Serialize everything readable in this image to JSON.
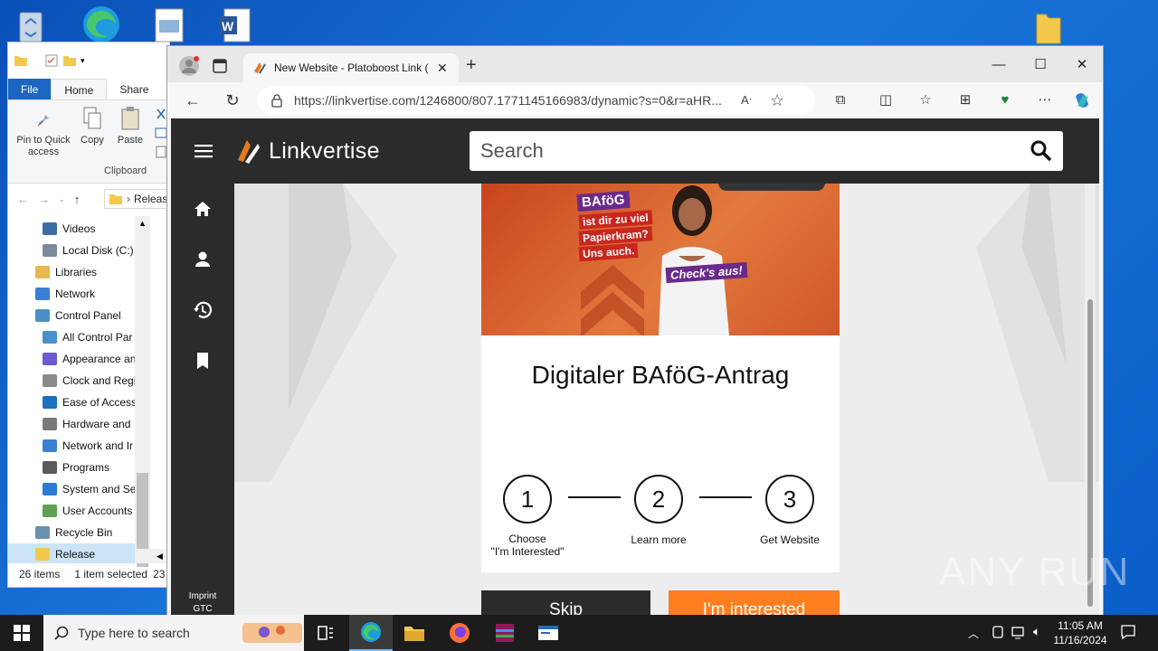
{
  "explorer": {
    "ribbon_tabs": [
      "File",
      "Home",
      "Share"
    ],
    "ribbon": {
      "pin_label": "Pin to Quick access",
      "copy_label": "Copy",
      "paste_label": "Paste",
      "group_label": "Clipboard"
    },
    "address_text": "Releas",
    "nav_items": [
      {
        "label": "Videos",
        "icon": "videos-icon",
        "color": "#3a6ea5"
      },
      {
        "label": "Local Disk (C:)",
        "icon": "drive-icon",
        "color": "#7a8a9a"
      },
      {
        "label": "Libraries",
        "icon": "libraries-icon",
        "color": "#e8b84a"
      },
      {
        "label": "Network",
        "icon": "network-icon",
        "color": "#3b7fd4"
      },
      {
        "label": "Control Panel",
        "icon": "control-panel-icon",
        "color": "#4a90c8"
      },
      {
        "label": "All Control Par",
        "icon": "control-panel-icon",
        "color": "#4a90c8"
      },
      {
        "label": "Appearance an",
        "icon": "appearance-icon",
        "color": "#6a5acd"
      },
      {
        "label": "Clock and Regi",
        "icon": "clock-icon",
        "color": "#8a8a8a"
      },
      {
        "label": "Ease of Access",
        "icon": "ease-of-access-icon",
        "color": "#1f6fbf"
      },
      {
        "label": "Hardware and",
        "icon": "printer-icon",
        "color": "#7a7a7a"
      },
      {
        "label": "Network and Ir",
        "icon": "network-icon",
        "color": "#3b7fd4"
      },
      {
        "label": "Programs",
        "icon": "programs-icon",
        "color": "#5a5a5a"
      },
      {
        "label": "System and Sec",
        "icon": "shield-icon",
        "color": "#2a7ad4"
      },
      {
        "label": "User Accounts",
        "icon": "users-icon",
        "color": "#5fa052"
      },
      {
        "label": "Recycle Bin",
        "icon": "recycle-bin-icon",
        "color": "#6a8fb0"
      },
      {
        "label": "Release",
        "icon": "folder-icon",
        "color": "#f2c94c"
      }
    ],
    "status": {
      "items_count": "26 items",
      "selected": "1 item selected",
      "size": "23"
    }
  },
  "browser": {
    "tab_title": "New Website - Platoboost Link (",
    "url": "https://linkvertise.com/1246800/807.1771145166983/dynamic?s=0&r=aHR...",
    "page": {
      "brand": "Linkvertise",
      "search_placeholder": "Search",
      "ad_text_1": "BAföG",
      "ad_text_2": "ist dir zu viel",
      "ad_text_3": "Papierkram?",
      "ad_text_4": "Uns auch.",
      "ad_cta": "Check's aus!",
      "card_title": "Digitaler BAföG-Antrag",
      "steps": [
        {
          "number": "1",
          "label_line1": "Choose",
          "label_line2": "\"I'm Interested\""
        },
        {
          "number": "2",
          "label_line1": "Learn more",
          "label_line2": ""
        },
        {
          "number": "3",
          "label_line1": "Get Website",
          "label_line2": ""
        }
      ],
      "skip_label": "Skip",
      "interested_label": "I'm interested",
      "footer_imprint": "Imprint",
      "footer_gtc": "GTC"
    }
  },
  "taskbar": {
    "search_placeholder": "Type here to search",
    "time": "11:05 AM",
    "date": "11/16/2024"
  },
  "watermark": "ANY RUN"
}
